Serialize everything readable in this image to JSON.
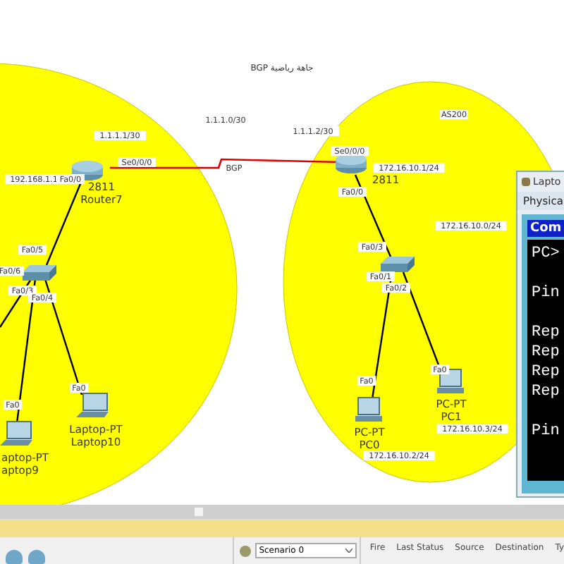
{
  "title": "BGP جاهة رياضية",
  "annotations": [
    "1.1.1.1/30",
    "Se0/0/0",
    "192.168.1.1",
    "Fa0/0",
    "1.1.1.0/30",
    "BGP",
    "1.1.1.2/30",
    "Se0/0/0",
    "Fa0/0",
    "172.16.10.1/24",
    "AS200",
    "172.16.10.0/24",
    "Fa0/3",
    "Fa0/1",
    "Fa0/2",
    "Fa0",
    "Fa0",
    "172.16.10.2/24",
    "172.16.10.3/24",
    "Fa0/5",
    "Fa0/6",
    "Fa0/3",
    "Fa0/4",
    "Fa0",
    "Fa0"
  ],
  "devices": [
    {
      "kind": "router",
      "labels": [
        "2811",
        "Router7"
      ]
    },
    {
      "kind": "router",
      "labels": [
        "2811"
      ]
    },
    {
      "kind": "switch"
    },
    {
      "kind": "switch"
    },
    {
      "kind": "laptop",
      "labels": [
        "aptop-PT",
        "aptop9"
      ]
    },
    {
      "kind": "laptop",
      "labels": [
        "Laptop-PT",
        "Laptop10"
      ]
    },
    {
      "kind": "pc",
      "labels": [
        "PC-PT",
        "PC0"
      ]
    },
    {
      "kind": "pc",
      "labels": [
        "PC-PT",
        "PC1"
      ]
    }
  ],
  "laptop_window": {
    "title": "Lapto",
    "tab": "Physica",
    "heading": "Com",
    "lines": [
      "PC>",
      "Pin",
      "Rep",
      "Rep",
      "Rep",
      "Rep",
      "Pin"
    ]
  },
  "simulation_panel": {
    "scenario": "Scenario 0",
    "columns": [
      "Fire",
      "Last Status",
      "Source",
      "Destination",
      "Ty"
    ]
  }
}
